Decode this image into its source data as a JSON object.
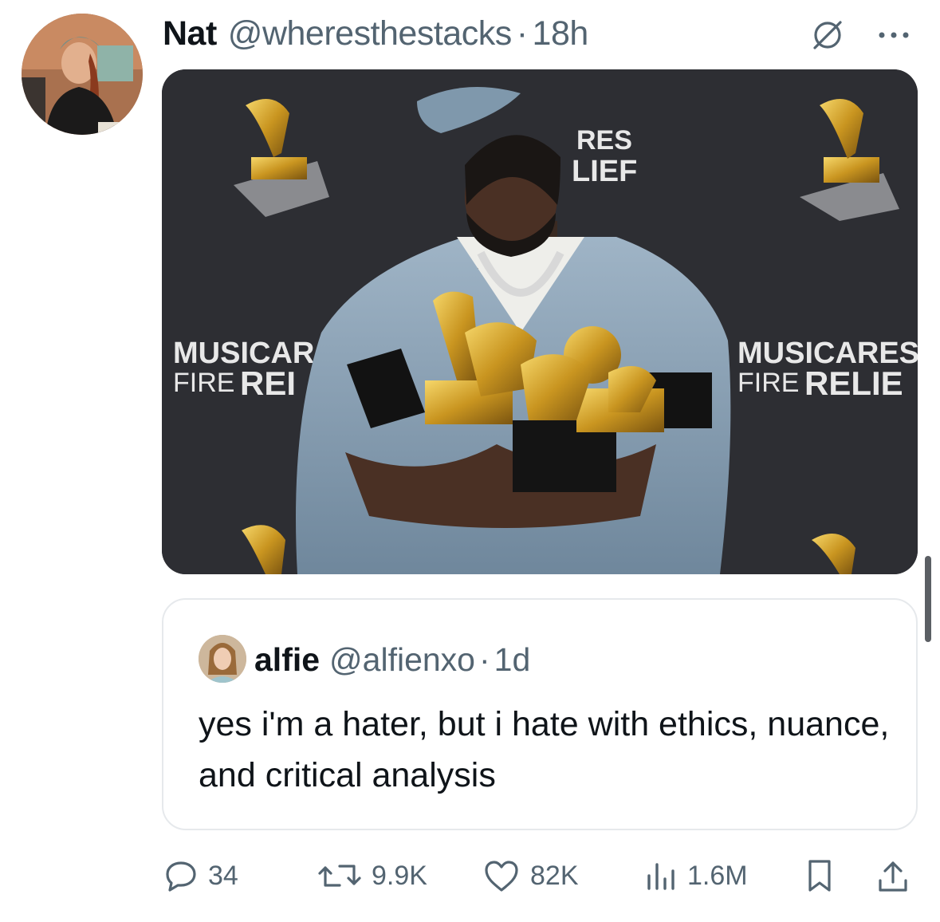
{
  "tweet": {
    "author_name": "Nat",
    "author_handle": "@wheresthestacks",
    "separator": "·",
    "time": "18h",
    "avatar_icon": "user-avatar",
    "media": {
      "backdrop_text_left_line1": "MUSICAR",
      "backdrop_text_left_line2_small": "FIRE",
      "backdrop_text_left_line2_big": "REI",
      "backdrop_text_right_line1": "MUSICARES",
      "backdrop_text_right_line2_small": "FIRE",
      "backdrop_text_right_line2_big": "RELIE",
      "backdrop_text_top_line1": "RES",
      "backdrop_text_top_line2": "LIEF"
    }
  },
  "quote": {
    "author_name": "alfie",
    "author_handle": "@alfienxo",
    "separator": "·",
    "time": "1d",
    "text": "yes i'm a hater, but i hate with ethics, nuance, and critical analysis"
  },
  "actions": {
    "replies": "34",
    "reposts": "9.9K",
    "likes": "82K",
    "views": "1.6M"
  },
  "icons": [
    "grok-icon",
    "more-icon",
    "reply-icon",
    "repost-icon",
    "like-icon",
    "views-icon",
    "bookmark-icon",
    "share-icon"
  ],
  "colors": {
    "text": "#0f1419",
    "secondary": "#536471",
    "border": "#e6e9ec"
  }
}
